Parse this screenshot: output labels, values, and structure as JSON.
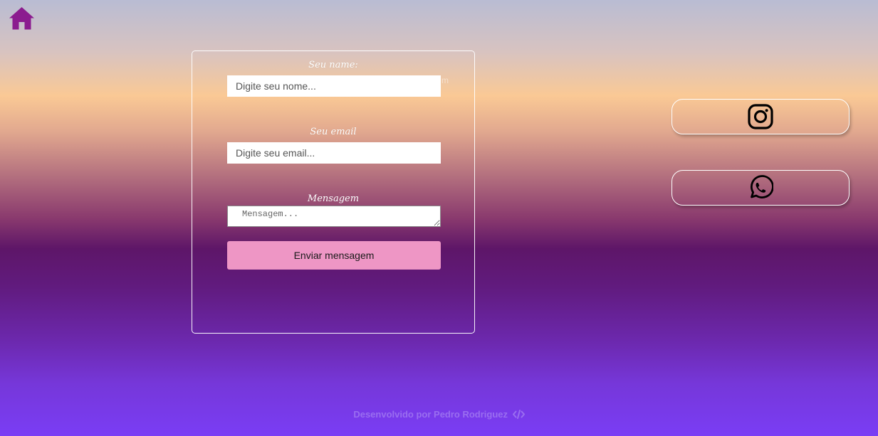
{
  "nav": {
    "home_icon": "home-icon",
    "home_color": "#8b1c8f"
  },
  "form": {
    "name_label": "Seu name:",
    "name_placeholder": "Digite seu nome...",
    "email_label": "Seu email",
    "email_placeholder": "Digite seu email...",
    "message_label": "Mensagem",
    "message_placeholder": "Mensagem...",
    "submit_label": "Enviar mensagem",
    "submit_color": "#ee96c5",
    "ghost_text": "m"
  },
  "social": {
    "items": [
      {
        "name": "Instagram",
        "icon": "instagram-icon"
      },
      {
        "name": "WhatsApp",
        "icon": "whatsapp-icon"
      }
    ]
  },
  "footer": {
    "credit": "Desenvolvido por Pedro Rodriguez",
    "icon": "code-icon",
    "color": "#9a6ef0"
  }
}
